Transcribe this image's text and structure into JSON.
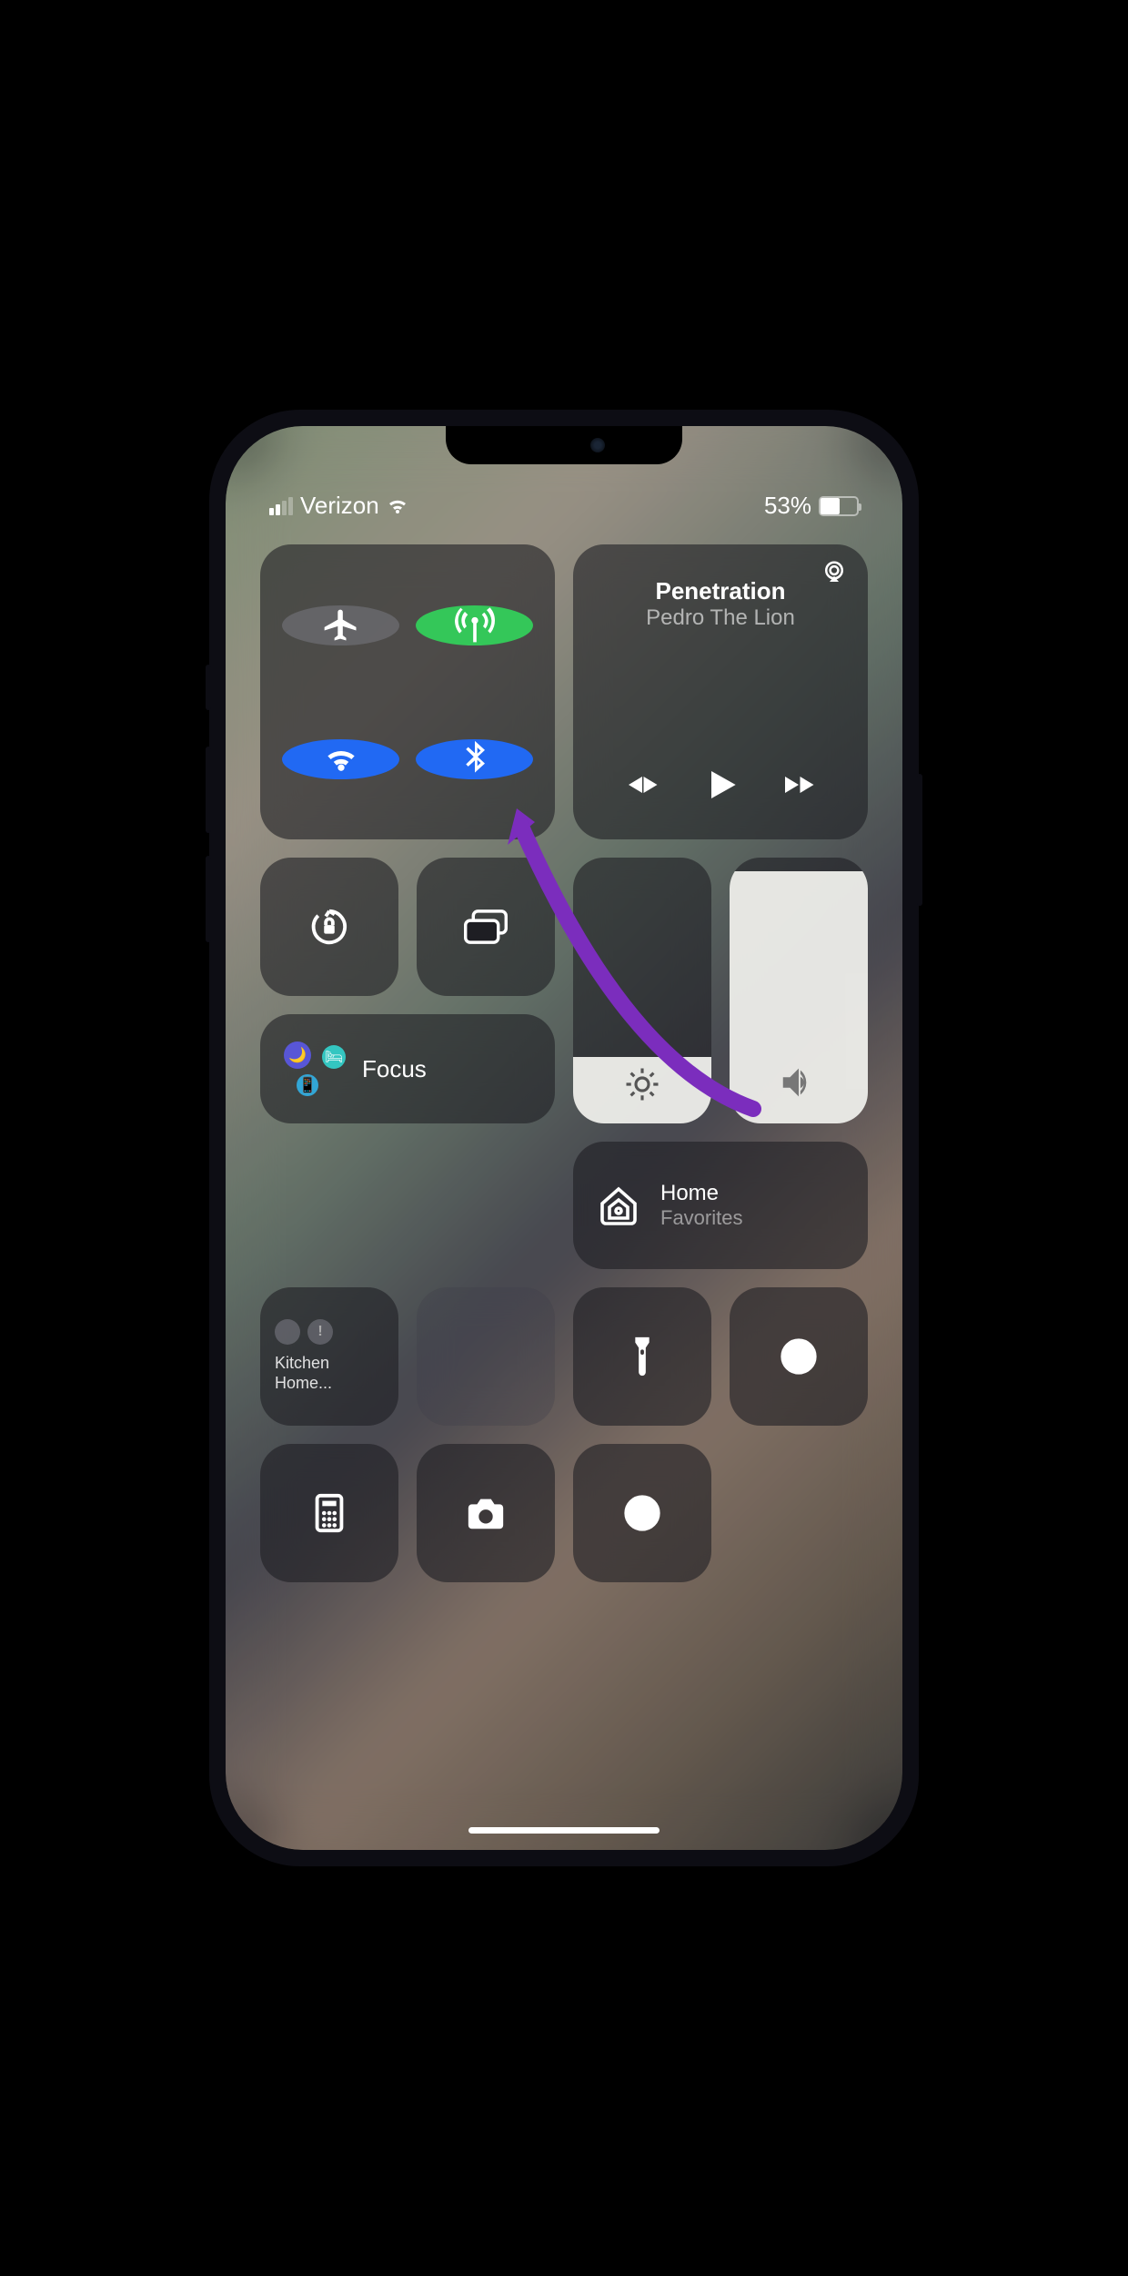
{
  "status": {
    "carrier": "Verizon",
    "battery_percent": "53%"
  },
  "connectivity": {
    "airplane": {
      "active": false
    },
    "cellular": {
      "active": true
    },
    "wifi": {
      "active": true
    },
    "bluetooth": {
      "active": true
    }
  },
  "now_playing": {
    "title": "Penetration",
    "artist": "Pedro The Lion"
  },
  "focus": {
    "label": "Focus"
  },
  "home": {
    "title": "Home",
    "subtitle": "Favorites"
  },
  "kitchen": {
    "line1": "Kitchen",
    "line2": "Home..."
  },
  "sliders": {
    "brightness": 25,
    "volume": 95
  }
}
